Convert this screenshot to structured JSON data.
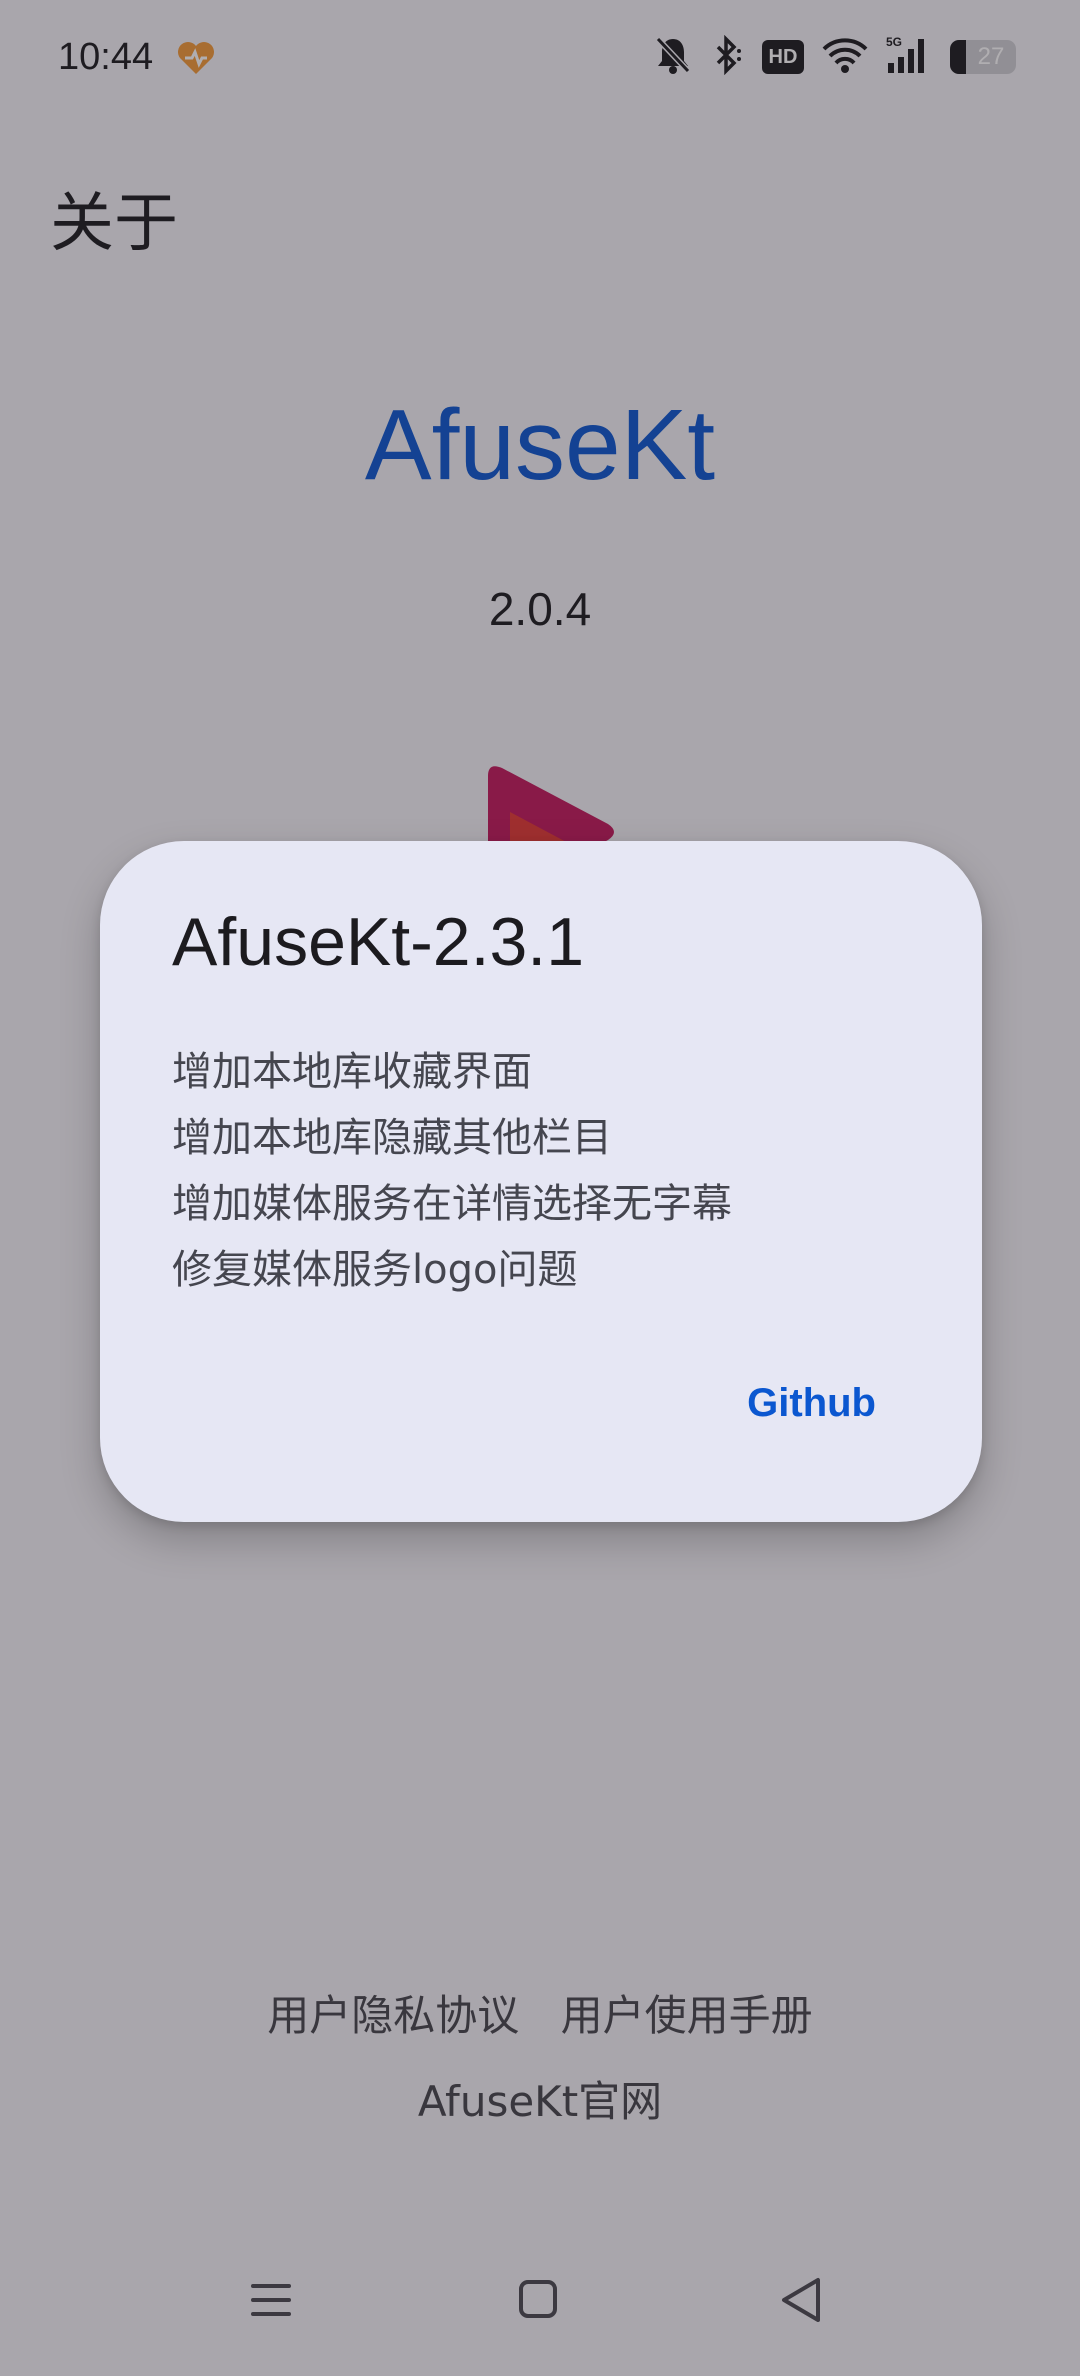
{
  "status_bar": {
    "time": "10:44",
    "battery_level": "27",
    "icons": [
      "notification-app-icon",
      "bell-muted-icon",
      "bluetooth-icon",
      "hd-icon",
      "wifi-icon",
      "signal-5g-icon",
      "battery-icon"
    ],
    "hd_label": "HD"
  },
  "page": {
    "title": "关于",
    "app_name": "AfuseKt",
    "app_version": "2.0.4"
  },
  "dialog": {
    "title": "AfuseKt-2.3.1",
    "changelog": [
      "增加本地库收藏界面",
      "增加本地库隐藏其他栏目",
      "增加媒体服务在详情选择无字幕",
      "修复媒体服务logo问题"
    ],
    "action_label": "Github"
  },
  "footer": {
    "privacy_link": "用户隐私协议",
    "manual_link": "用户使用手册",
    "website_link": "AfuseKt官网"
  },
  "colors": {
    "accent": "#0b57d0",
    "dialog_bg": "#e6e7f4",
    "scrim": "rgba(35,30,40,0.36)",
    "logo_primary": "#c2185b",
    "logo_secondary": "#e53935"
  }
}
